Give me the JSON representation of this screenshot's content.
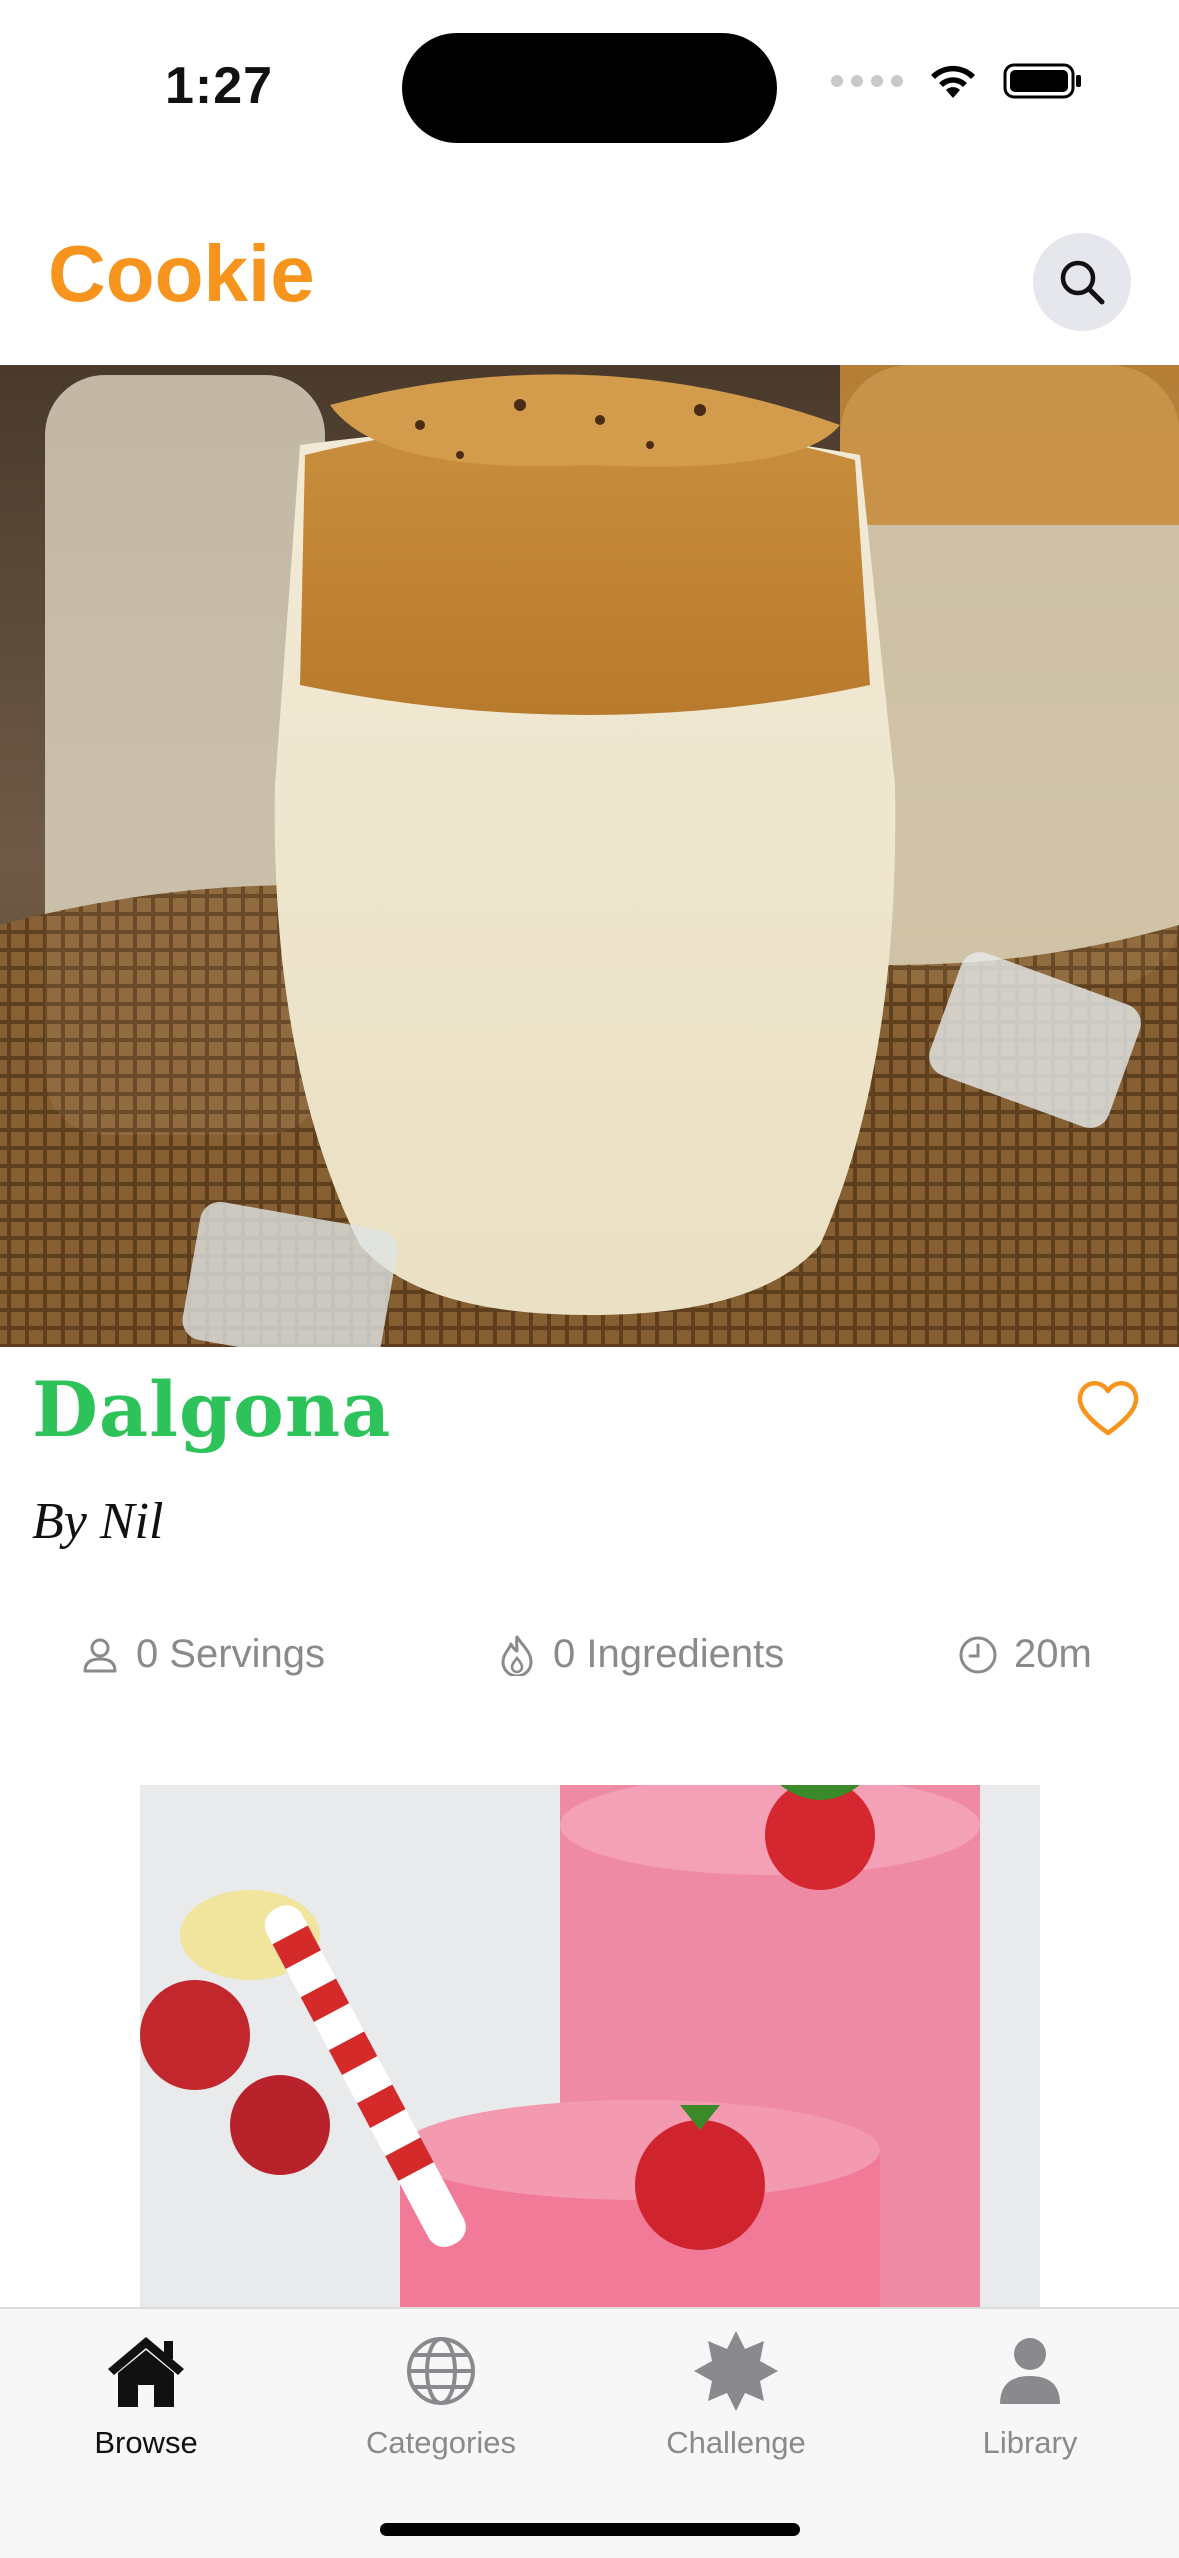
{
  "status_bar": {
    "time": "1:27"
  },
  "header": {
    "app_title": "Cookie"
  },
  "recipe": {
    "title": "Dalgona",
    "author": "By Nil",
    "servings": "0 Servings",
    "ingredients": "0 Ingredients",
    "time": "20m"
  },
  "tab_bar": {
    "tabs": [
      {
        "label": "Browse",
        "icon": "house-icon",
        "active": true
      },
      {
        "label": "Categories",
        "icon": "globe-icon",
        "active": false
      },
      {
        "label": "Challenge",
        "icon": "star-badge-icon",
        "active": false
      },
      {
        "label": "Library",
        "icon": "person-icon",
        "active": false
      }
    ]
  },
  "colors": {
    "brand": "#f7941d",
    "title_green": "#2ec25a",
    "muted": "#8a8a8e"
  }
}
